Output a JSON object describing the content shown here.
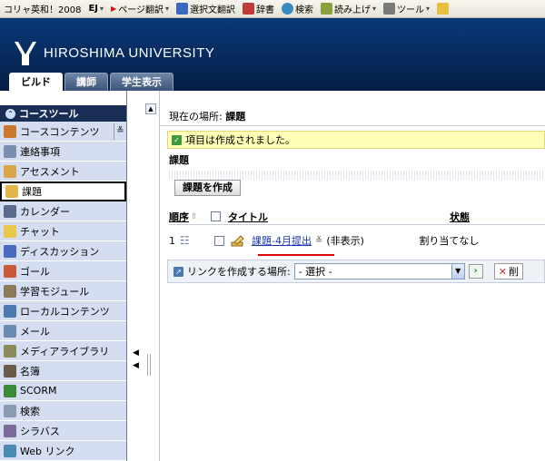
{
  "toolbar": {
    "items": [
      {
        "label": "コリャ英和！2008"
      },
      {
        "label": "EJ"
      },
      {
        "label": "ページ翻訳"
      },
      {
        "label": "選択文翻訳"
      },
      {
        "label": "辞書"
      },
      {
        "label": "検索"
      },
      {
        "label": "読み上げ"
      },
      {
        "label": "ツール"
      }
    ]
  },
  "header": {
    "university": "HIROSHIMA UNIVERSITY",
    "tabs": [
      {
        "label": "ビルド",
        "active": true
      },
      {
        "label": "講師",
        "active": false
      },
      {
        "label": "学生表示",
        "active": false
      }
    ]
  },
  "sidebar": {
    "heading": "コースツール",
    "items": [
      {
        "label": "コースコンテンツ",
        "icon": "course-content-icon",
        "color": "#c97a2a",
        "active": false,
        "collapse": true
      },
      {
        "label": "連絡事項",
        "icon": "announcement-icon",
        "color": "#7a8fb0",
        "active": false
      },
      {
        "label": "アセスメント",
        "icon": "assessment-icon",
        "color": "#d9a64a",
        "active": false
      },
      {
        "label": "課題",
        "icon": "assignment-icon",
        "color": "#e4b64a",
        "active": true
      },
      {
        "label": "カレンダー",
        "icon": "calendar-icon",
        "color": "#5a6a8a",
        "active": false
      },
      {
        "label": "チャット",
        "icon": "chat-icon",
        "color": "#e8c84a",
        "active": false
      },
      {
        "label": "ディスカッション",
        "icon": "discussion-icon",
        "color": "#4a6ac0",
        "active": false
      },
      {
        "label": "ゴール",
        "icon": "goal-icon",
        "color": "#c85a3a",
        "active": false
      },
      {
        "label": "学習モジュール",
        "icon": "learning-module-icon",
        "color": "#8a7a5a",
        "active": false
      },
      {
        "label": "ローカルコンテンツ",
        "icon": "local-content-icon",
        "color": "#4a7ab0",
        "active": false
      },
      {
        "label": "メール",
        "icon": "mail-icon",
        "color": "#6a8ab0",
        "active": false
      },
      {
        "label": "メディアライブラリ",
        "icon": "media-library-icon",
        "color": "#8a8a5a",
        "active": false
      },
      {
        "label": "名簿",
        "icon": "roster-icon",
        "color": "#6a5a4a",
        "active": false
      },
      {
        "label": "SCORM",
        "icon": "scorm-icon",
        "color": "#3a8a3a",
        "active": false
      },
      {
        "label": "検索",
        "icon": "search-icon",
        "color": "#8a9ab0",
        "active": false
      },
      {
        "label": "シラバス",
        "icon": "syllabus-icon",
        "color": "#7a6a9a",
        "active": false
      },
      {
        "label": "Web リンク",
        "icon": "web-link-icon",
        "color": "#4a8ab0",
        "active": false
      }
    ]
  },
  "main": {
    "crumb_label": "現在の場所:",
    "crumb_value": "課題",
    "notice": "項目は作成されました。",
    "title": "課題",
    "create_button": "課題を作成",
    "columns": {
      "order": "順序",
      "title": "タイトル",
      "status": "状態"
    },
    "rows": [
      {
        "order": "1",
        "title": "課題-4月提出",
        "visibility": "(非表示)",
        "status": "割り当てなし"
      }
    ],
    "link_label": "リンクを作成する場所:",
    "select_value": "- 選択 -",
    "delete_label": "削"
  },
  "colors": {
    "header": "#0a3a7a",
    "sidebar_item": "#d4def0",
    "link": "#1a35b0",
    "highlight": "#e00000"
  }
}
